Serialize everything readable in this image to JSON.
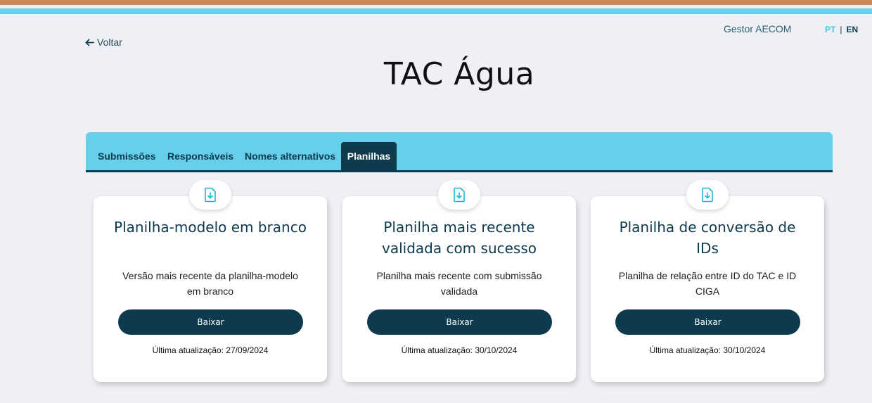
{
  "header": {
    "back_label": "Voltar",
    "user_name": "Gestor AECOM",
    "lang_pt": "PT",
    "lang_separator": "|",
    "lang_en": "EN"
  },
  "page": {
    "title": "TAC Água"
  },
  "tabs": [
    {
      "label": "Submissões",
      "active": false
    },
    {
      "label": "Responsáveis",
      "active": false
    },
    {
      "label": "Nomes alternativos",
      "active": false
    },
    {
      "label": "Planilhas",
      "active": true
    }
  ],
  "cards": [
    {
      "icon": "download-file-icon",
      "title": "Planilha-modelo em branco",
      "description": "Versão mais recente da planilha-modelo em branco",
      "button_label": "Baixar",
      "updated": "Última atualização: 27/09/2024"
    },
    {
      "icon": "download-file-icon",
      "title": "Planilha mais recente validada com sucesso",
      "description": "Planilha mais recente com submissão validada",
      "button_label": "Baixar",
      "updated": "Última atualização: 30/10/2024"
    },
    {
      "icon": "download-file-icon",
      "title": "Planilha de conversão de IDs",
      "description": "Planilha de relação entre ID do TAC e ID CIGA",
      "button_label": "Baixar",
      "updated": "Última atualização: 30/10/2024"
    }
  ],
  "colors": {
    "accent_blue": "#66cfe9",
    "dark_navy": "#0d3a4d",
    "top_orange": "#c98a55",
    "background": "#eef0f6"
  }
}
